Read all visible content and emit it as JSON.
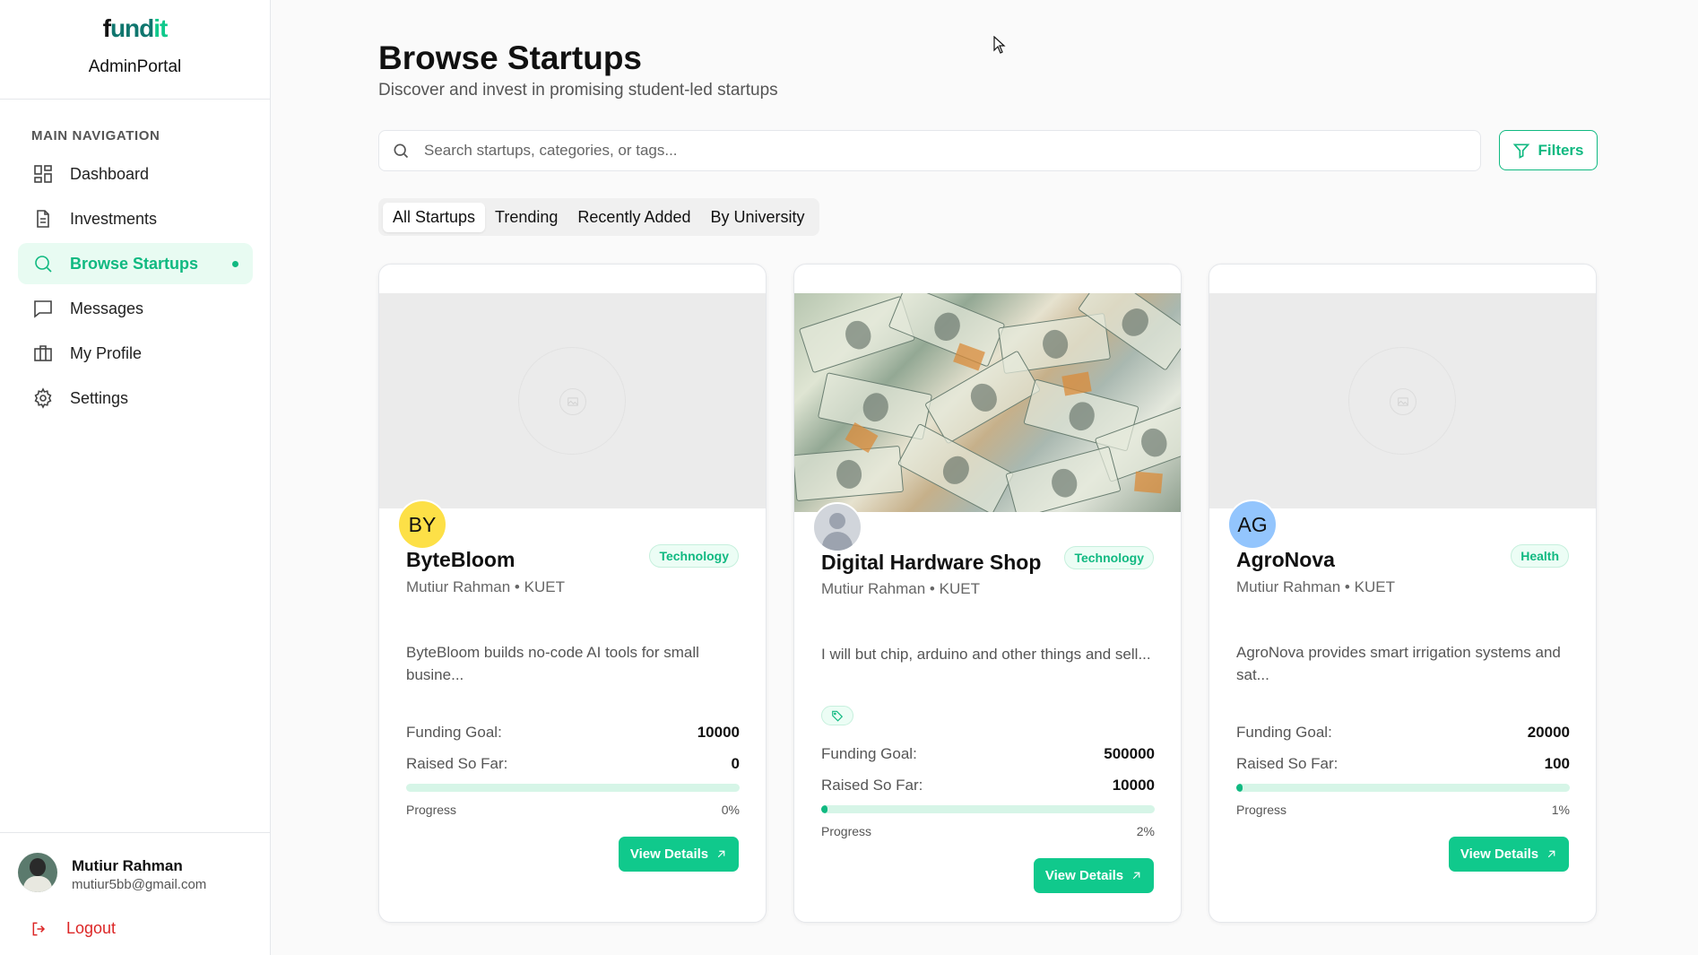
{
  "brand": {
    "logo_text": "fundit",
    "portal": "AdminPortal"
  },
  "sidebar": {
    "section_title": "MAIN NAVIGATION",
    "items": [
      {
        "label": "Dashboard",
        "icon": "dashboard-icon"
      },
      {
        "label": "Investments",
        "icon": "document-icon"
      },
      {
        "label": "Browse Startups",
        "icon": "search-icon",
        "active": true
      },
      {
        "label": "Messages",
        "icon": "message-icon"
      },
      {
        "label": "My Profile",
        "icon": "briefcase-icon"
      },
      {
        "label": "Settings",
        "icon": "gear-icon"
      }
    ],
    "user": {
      "name": "Mutiur Rahman",
      "email": "mutiur5bb@gmail.com"
    },
    "logout": "Logout"
  },
  "header": {
    "title": "Browse Startups",
    "subtitle": "Discover and invest in promising student-led startups"
  },
  "search": {
    "placeholder": "Search startups, categories, or tags...",
    "value": ""
  },
  "filters_label": "Filters",
  "tabs": [
    {
      "label": "All Startups",
      "active": true
    },
    {
      "label": "Trending"
    },
    {
      "label": "Recently Added"
    },
    {
      "label": "By University"
    }
  ],
  "cards": [
    {
      "initials": "BY",
      "avatar_color": "#fde047",
      "name": "ByteBloom",
      "category": "Technology",
      "meta": "Mutiur Rahman • KUET",
      "description": "ByteBloom builds no-code AI tools for small busine...",
      "goal_label": "Funding Goal:",
      "goal": "10000",
      "raised_label": "Raised So Far:",
      "raised": "0",
      "progress_label": "Progress",
      "progress_text": "0%",
      "progress": 0,
      "button": "View Details"
    },
    {
      "initials": "",
      "avatar_color": "#d1d5db",
      "name": "Digital Hardware Shop",
      "category": "Technology",
      "meta": "Mutiur Rahman • KUET",
      "description": "I will but chip, arduino and other things and sell...",
      "goal_label": "Funding Goal:",
      "goal": "500000",
      "raised_label": "Raised So Far:",
      "raised": "10000",
      "progress_label": "Progress",
      "progress_text": "2%",
      "progress": 0.02,
      "button": "View Details"
    },
    {
      "initials": "AG",
      "avatar_color": "#93c5fd",
      "name": "AgroNova",
      "category": "Health",
      "meta": "Mutiur Rahman • KUET",
      "description": "AgroNova provides smart irrigation systems and sat...",
      "goal_label": "Funding Goal:",
      "goal": "20000",
      "raised_label": "Raised So Far:",
      "raised": "100",
      "progress_label": "Progress",
      "progress_text": "1%",
      "progress": 0.01,
      "button": "View Details"
    }
  ]
}
